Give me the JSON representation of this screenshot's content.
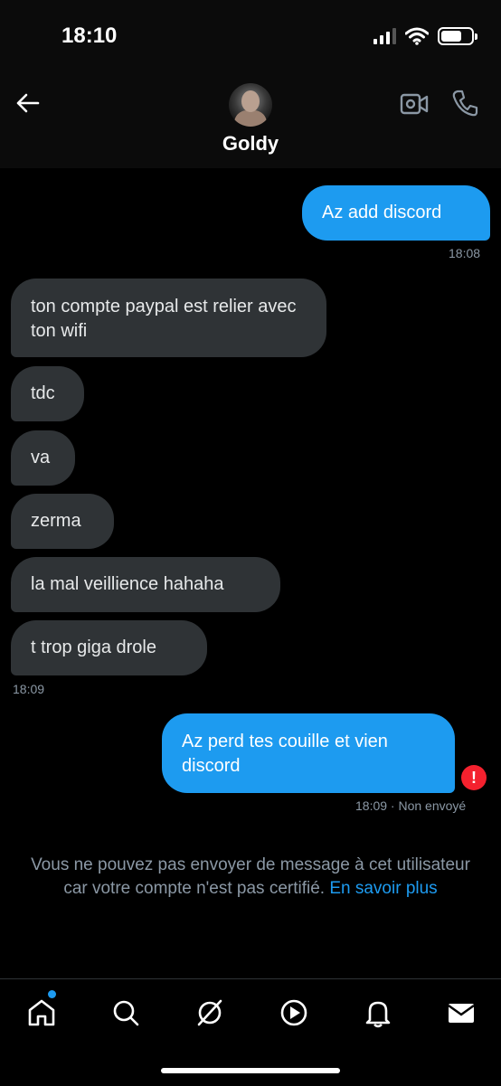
{
  "status": {
    "time": "18:10",
    "battery_level": 0.7
  },
  "header": {
    "name": "Goldy"
  },
  "messages": [
    {
      "text": "Az add discord",
      "direction": "out"
    },
    {
      "text": "ton compte paypal est relier avec ton wifi",
      "direction": "in"
    },
    {
      "text": "tdc",
      "direction": "in"
    },
    {
      "text": "va",
      "direction": "in"
    },
    {
      "text": "zerma",
      "direction": "in"
    },
    {
      "text": "la mal veillience hahaha",
      "direction": "in"
    },
    {
      "text": "t trop giga drole",
      "direction": "in"
    },
    {
      "text": "Az perd tes couille et vien discord",
      "direction": "out",
      "failed": true
    }
  ],
  "timestamps": {
    "t1": "18:08",
    "t2": "18:09",
    "t3": "18:09 · Non envoyé"
  },
  "notice": {
    "text": "Vous ne pouvez pas envoyer de message à cet utilisateur car votre compte n'est pas certifié. ",
    "link": "En savoir plus"
  },
  "icons": {
    "back": "arrow-left-icon",
    "video": "video-camera-icon",
    "phone": "phone-icon",
    "error": "exclamation-icon",
    "nav": [
      "home-icon",
      "search-icon",
      "grok-icon",
      "play-icon",
      "bell-icon",
      "mail-icon"
    ]
  },
  "colors": {
    "accent": "#1d9bf0",
    "incoming_bubble": "#2f3336",
    "error": "#f4212e"
  }
}
